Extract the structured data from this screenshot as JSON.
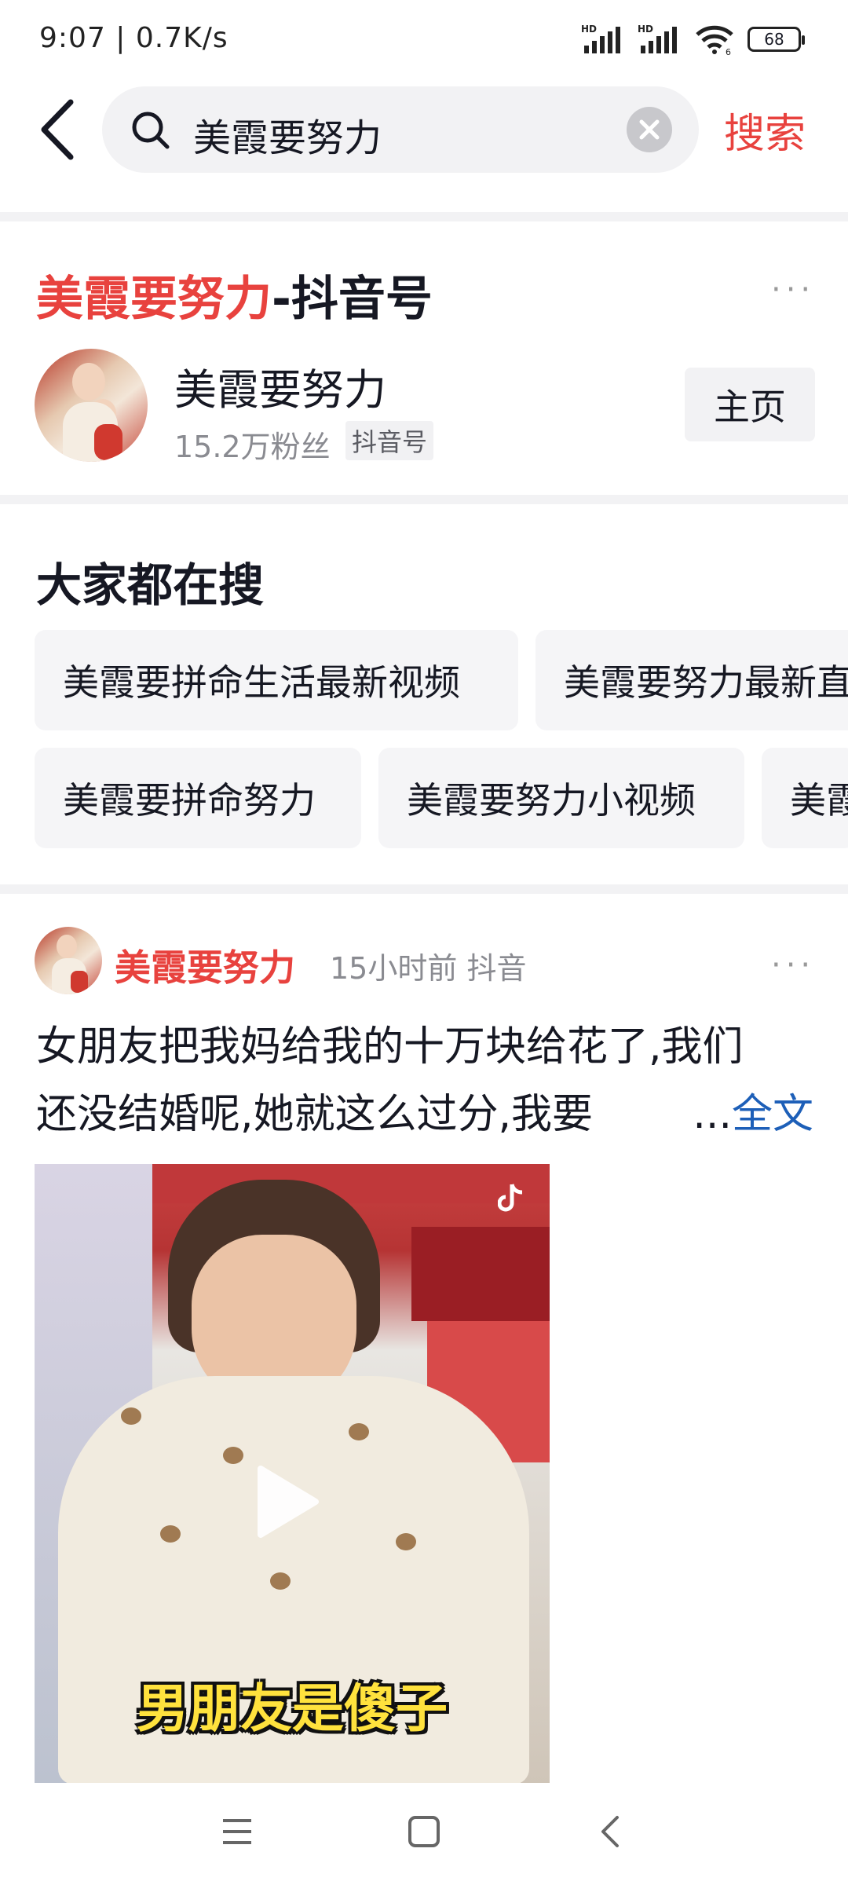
{
  "status_bar": {
    "time_speed": "9:07 | 0.7K/s",
    "battery": "68",
    "net_labels": [
      "HD",
      "HD"
    ],
    "wifi_sub": "6"
  },
  "search": {
    "query": "美霞要努力",
    "submit_label": "搜索"
  },
  "account": {
    "title_highlight": "美霞要努力",
    "title_suffix": "-抖音号",
    "name": "美霞要努力",
    "fans": "15.2万粉丝",
    "tag": "抖音号",
    "home_label": "主页",
    "more": "···"
  },
  "everyone_search": {
    "title": "大家都在搜",
    "row1": [
      "美霞要拼命生活最新视频",
      "美霞要努力最新直"
    ],
    "row2": [
      "美霞要拼命努力",
      "美霞要努力小视频",
      "美霞"
    ]
  },
  "post": {
    "author": "美霞要努力",
    "time": "15小时前",
    "source": "抖音",
    "more": "···",
    "text_line1": "女朋友把我妈给我的十万块给花了,我们",
    "text_line2": "还没结婚呢,她就这么过分,我要",
    "ellipsis": "...",
    "full_label": "全文",
    "video_caption": "男朋友是傻子"
  },
  "colors": {
    "accent": "#e8423e",
    "link": "#1d5fb8",
    "chip_bg": "#f5f5f7"
  }
}
